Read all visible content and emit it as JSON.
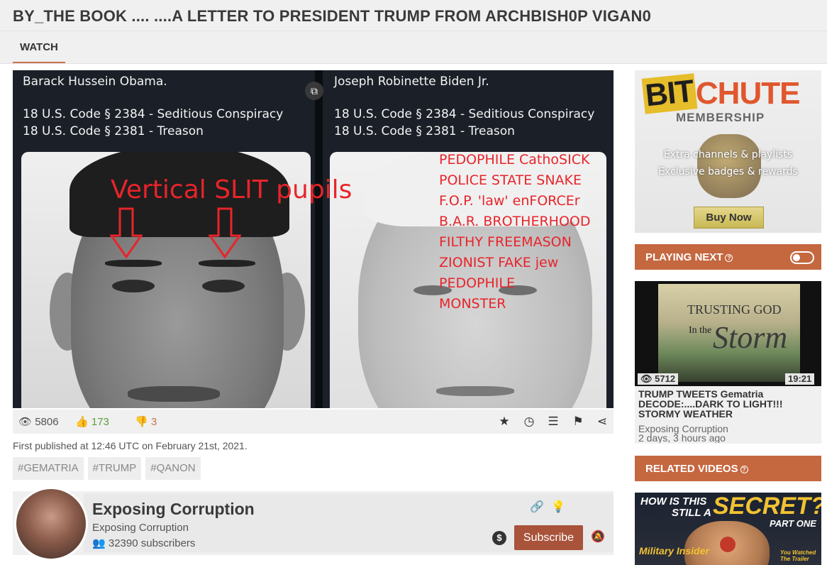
{
  "page": {
    "title": "BY_THE BOOK .... ....A LETTER TO PRESIDENT TRUMP FROM ARCHBISH0P VIGAN0",
    "tab": "WATCH"
  },
  "video": {
    "left_panel": {
      "name": "Barack Hussein Obama.",
      "code1": "18 U.S. Code § 2384 - Seditious Conspiracy",
      "code2": "18 U.S. Code § 2381 - Treason"
    },
    "right_panel": {
      "name": "Joseph Robinette Biden Jr.",
      "code1": "18 U.S. Code § 2384 - Seditious Conspiracy",
      "code2": "18 U.S. Code § 2381 - Treason"
    },
    "overlay_caption": "Vertical SLIT pupils",
    "overlay_list": [
      "PEDOPHILE CathoSICK",
      "POLICE STATE SNAKE",
      "F.O.P. 'law' enFORCEr",
      "B.A.R. BROTHERHOOD",
      "FILTHY  FREEMASON",
      "ZIONIST FAKE jew",
      "PEDOPHILE",
      "MONSTER"
    ],
    "overlay_color": "#e8242a"
  },
  "stats": {
    "views": "5806",
    "likes": "173",
    "dislikes": "3"
  },
  "published": "First published at 12:46 UTC on February 21st, 2021.",
  "tags": [
    "#GEMATRIA",
    "#TRUMP",
    "#QANON"
  ],
  "channel": {
    "name": "Exposing Corruption",
    "owner": "Exposing Corruption",
    "subscribers": "32390 subscribers",
    "subscribe_label": "Subscribe"
  },
  "ad": {
    "logo_bit": "BIT",
    "logo_chute": "CHUTE",
    "membership": "MEMBERSHIP",
    "line1": "Extra channels & playlists",
    "line2": "Exclusive badges & rewards",
    "cta": "Buy Now"
  },
  "playing_next": {
    "heading": "PLAYING NEXT",
    "thumb_title_line1": "TRUSTING GOD",
    "thumb_title_line2": "In the",
    "thumb_title_line3": "Storm",
    "views": "5712",
    "duration": "19:21",
    "title": "TRUMP TWEETS Gematria DECODE:....DARK TO LIGHT!!! STORMY WEATHER",
    "channel": "Exposing Corruption",
    "date": "2 days, 3 hours ago"
  },
  "related": {
    "heading": "RELATED VIDEOS",
    "thumb_line1": "HOW IS THIS",
    "thumb_line2": "STILL A",
    "thumb_line3": "SECRET?!",
    "thumb_line4": "PART ONE",
    "thumb_line5": "Military Insider",
    "thumb_line6": "You Watched The Trailer"
  },
  "colors": {
    "accent": "#c5673f",
    "subscribe": "#a8533a",
    "like": "#5f9c3f",
    "dislike": "#c9734d"
  }
}
